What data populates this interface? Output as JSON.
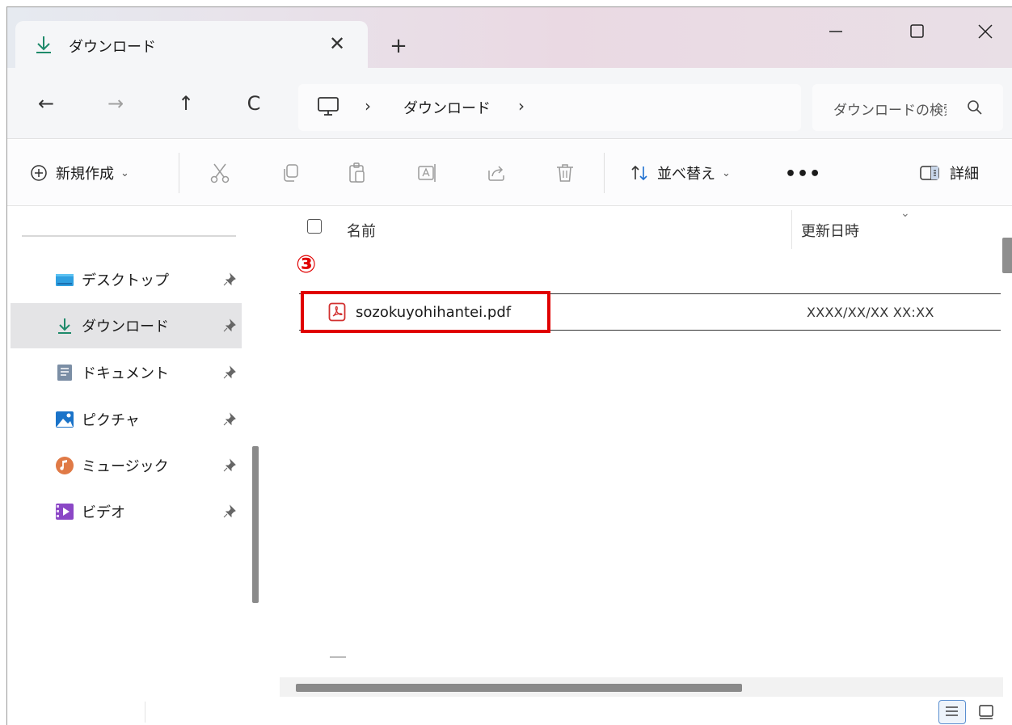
{
  "tab": {
    "title": "ダウンロード",
    "close": "✕",
    "new_tab": "+"
  },
  "window_controls": {
    "minimize": "—",
    "maximize": "☐",
    "close": "✕"
  },
  "nav": {
    "back": "←",
    "forward": "→",
    "up": "↑",
    "refresh": "C"
  },
  "address": {
    "separator1": "›",
    "folder": "ダウンロード",
    "separator2": "›"
  },
  "search": {
    "placeholder": "ダウンロードの検索"
  },
  "toolbar": {
    "new_label": "新規作成",
    "new_chevron": "⌄",
    "sort_label": "並べ替え",
    "sort_chevron": "⌄",
    "more": "•••",
    "details_label": "詳細"
  },
  "sidebar": {
    "items": [
      {
        "label": "デスクトップ",
        "icon": "desktop-folder-icon"
      },
      {
        "label": "ダウンロード",
        "icon": "download-icon",
        "selected": true
      },
      {
        "label": "ドキュメント",
        "icon": "documents-icon"
      },
      {
        "label": "ピクチャ",
        "icon": "pictures-icon"
      },
      {
        "label": "ミュージック",
        "icon": "music-icon"
      },
      {
        "label": "ビデオ",
        "icon": "videos-icon"
      }
    ]
  },
  "list": {
    "header_name": "名前",
    "header_date": "更新日時",
    "header_sort": "⌄",
    "annotation": "③",
    "files": [
      {
        "name": "sozokuyohihantei.pdf",
        "modified": "XXXX/XX/XX XX:XX",
        "icon": "pdf-file-icon"
      }
    ]
  },
  "colors": {
    "accent": "#0f8a6e",
    "highlight": "#e00000",
    "selected_bg": "#e4e4e6"
  }
}
